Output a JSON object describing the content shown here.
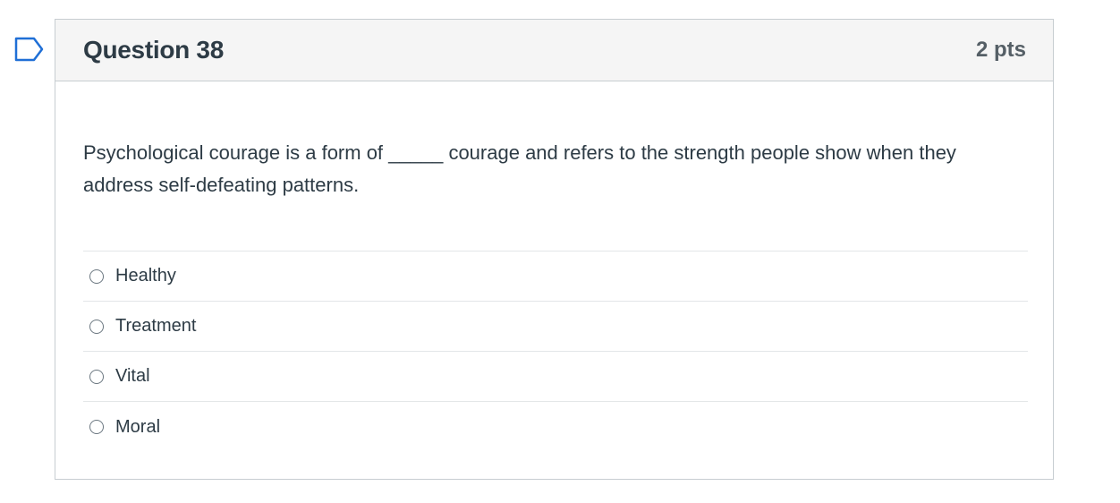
{
  "question": {
    "title": "Question 38",
    "points": "2 pts",
    "text": "Psychological courage is a form of _____ courage and refers to the strength people show when they address self-defeating patterns.",
    "flag_icon": "flag-question-icon"
  },
  "answers": [
    {
      "label": "Healthy",
      "selected": false
    },
    {
      "label": "Treatment",
      "selected": false
    },
    {
      "label": "Vital",
      "selected": false
    },
    {
      "label": "Moral",
      "selected": false
    }
  ],
  "colors": {
    "header_background": "#f5f5f5",
    "border": "#c7cdd1",
    "text": "#2d3b45",
    "flag_icon": "#1f6fd6"
  }
}
